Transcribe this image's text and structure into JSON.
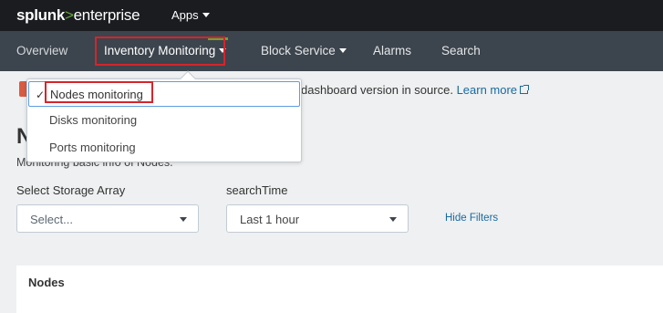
{
  "topbar": {
    "brand_part1": "splunk",
    "brand_part2": ">",
    "brand_part3": "enterprise",
    "apps_label": "Apps"
  },
  "nav": {
    "items": [
      {
        "label": "Overview"
      },
      {
        "label": "Inventory Monitoring"
      },
      {
        "label": "Block Service"
      },
      {
        "label": "Alarms"
      },
      {
        "label": "Search"
      }
    ]
  },
  "banner": {
    "text": "dashboard version in source.",
    "link_label": "Learn more"
  },
  "dashboard": {
    "title_fragment": "N",
    "description": "Monitoring basic info of Nodes."
  },
  "filters": {
    "storage_label": "Select Storage Array",
    "storage_value": "Select...",
    "time_label": "searchTime",
    "time_value": "Last 1 hour",
    "hide_filters_label": "Hide Filters"
  },
  "panel": {
    "title": "Nodes"
  },
  "menu": {
    "items": [
      {
        "label": "Nodes monitoring",
        "selected": true
      },
      {
        "label": "Disks monitoring"
      },
      {
        "label": "Ports monitoring"
      }
    ]
  },
  "colors": {
    "accent_green": "#65a637",
    "link_blue": "#1a6aa0",
    "highlight_red": "#d6242b"
  }
}
